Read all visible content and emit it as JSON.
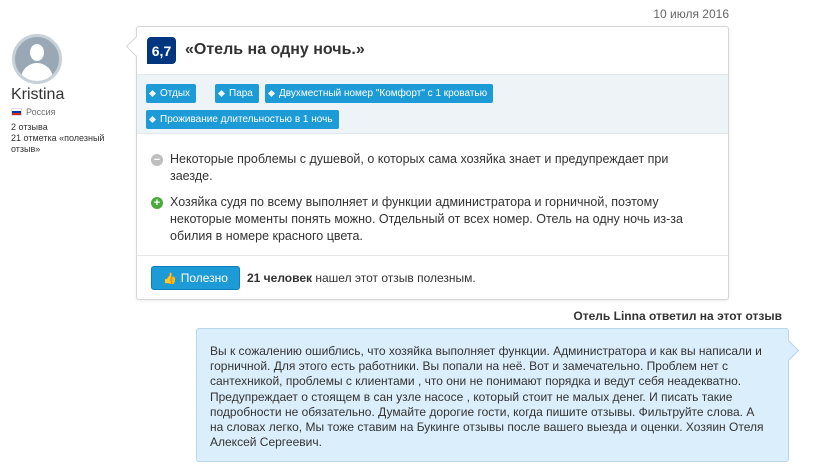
{
  "review": {
    "date": "10 июля 2016",
    "reviewer": {
      "name": "Kristina",
      "country": "Россия",
      "reviews_count": "2 отзыва",
      "helpful_count": "21 отметка «полезный отзыв»"
    },
    "score": "6,7",
    "title": "«Отель на одну ночь.»",
    "tags": [
      "Отдых",
      "Пара",
      "Двухместный номер \"Комфорт\" с 1 кроватью",
      "Проживание длительностью в 1 ночь"
    ],
    "negative": "Некоторые проблемы с душевой, о которых сама хозяйка знает и предупреждает при заезде.",
    "positive": "Хозяйка судя по всему выполняет и функции администратора и горничной, поэтому некоторые моменты понять можно. Отдельный от всех номер. Отель на одну ночь из-за обилия в номере красного цвета.",
    "helpful_button": "Полезно",
    "helpful_count_text": "21 человек",
    "helpful_suffix": "нашел этот отзыв полезным."
  },
  "hotel_reply": {
    "heading": "Отель Linna ответил на этот отзыв",
    "text": "Вы к сожалению ошиблись, что хозяйка выполняет функции. Администратора и как вы написали и горничной. Для этого есть работники. Вы попали на неё. Вот и замечательно. Проблем нет с сантехникой, проблемы с клиентами , что они не понимают порядка и ведут себя неадекватно. Предупреждает о стоящем в сан узле насосе , который стоит не малых денег. И писать такие подробности не обязательно. Думайте дорогие гости, когда пишите отзывы. Фильтруйте слова. А на словах легко, Мы тоже ставим на Букинге отзывы после вашего выезда и оценки. Хозяин Отеля Алексей Сергеевич."
  },
  "icons": {
    "avatar": "user-silhouette-icon",
    "flag": "russia-flag-icon",
    "negative": "minus-circle-icon",
    "positive": "plus-circle-icon",
    "helpful": "thumbs-up-icon"
  },
  "colors": {
    "score_badge": "#003580",
    "tag": "#1d9bd7",
    "helpful_button": "#1d9bd7",
    "reply_background": "#dbeefb",
    "positive_mark": "#4aab3c",
    "negative_mark": "#bfbfbf"
  }
}
